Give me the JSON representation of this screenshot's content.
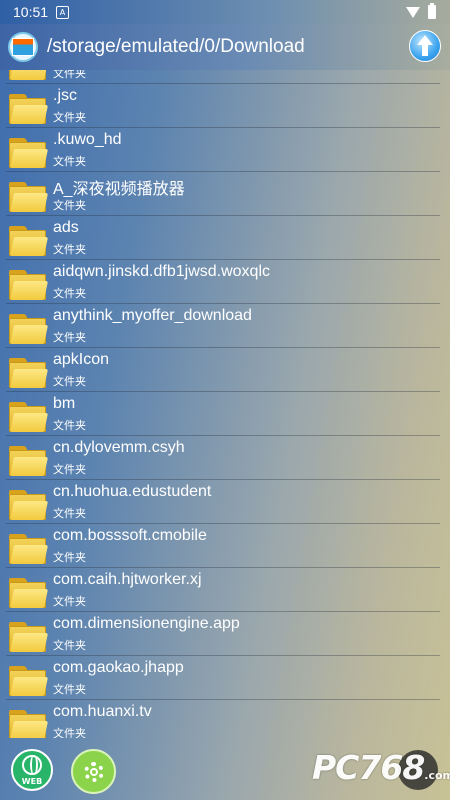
{
  "status_bar": {
    "time": "10:51",
    "notification_glyph": "A"
  },
  "header": {
    "path": "/storage/emulated/0/Download"
  },
  "file_type_label": "文件夹",
  "files": [
    {
      "name": "",
      "type": "文件夹"
    },
    {
      "name": ".jsc",
      "type": "文件夹"
    },
    {
      "name": ".kuwo_hd",
      "type": "文件夹"
    },
    {
      "name": "A_深夜视频播放器",
      "type": "文件夹"
    },
    {
      "name": "ads",
      "type": "文件夹"
    },
    {
      "name": "aidqwn.jinskd.dfb1jwsd.woxqlc",
      "type": "文件夹"
    },
    {
      "name": "anythink_myoffer_download",
      "type": "文件夹"
    },
    {
      "name": "apkIcon",
      "type": "文件夹"
    },
    {
      "name": "bm",
      "type": "文件夹"
    },
    {
      "name": "cn.dylovemm.csyh",
      "type": "文件夹"
    },
    {
      "name": "cn.huohua.edustudent",
      "type": "文件夹"
    },
    {
      "name": "com.bosssoft.cmobile",
      "type": "文件夹"
    },
    {
      "name": "com.caih.hjtworker.xj",
      "type": "文件夹"
    },
    {
      "name": "com.dimensionengine.app",
      "type": "文件夹"
    },
    {
      "name": "com.gaokao.jhapp",
      "type": "文件夹"
    },
    {
      "name": "com.huanxi.tv",
      "type": "文件夹"
    }
  ],
  "bottom_bar": {
    "web_label": "WEB"
  },
  "watermark": {
    "text": "PC768",
    "suffix": ".com"
  }
}
